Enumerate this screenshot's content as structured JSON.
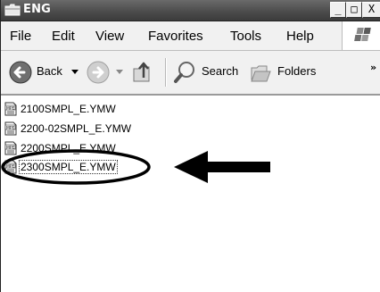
{
  "window": {
    "title": "ENG",
    "controls": {
      "minimize": "_",
      "maximize": "□",
      "close": "X"
    }
  },
  "menu": {
    "items": [
      "File",
      "Edit",
      "View",
      "Favorites",
      "Tools",
      "Help"
    ]
  },
  "toolbar": {
    "back_label": "Back",
    "search_label": "Search",
    "folders_label": "Folders",
    "overflow": "»"
  },
  "files": [
    {
      "name": "2100SMPL_E.YMW",
      "icon": "ymw-file-icon"
    },
    {
      "name": "2200-02SMPL_E.YMW",
      "icon": "ymw-file-icon"
    },
    {
      "name": "2200SMPL_E.YMW",
      "icon": "ymw-file-icon"
    },
    {
      "name": "2300SMPL_E.YMW",
      "icon": "ymw-file-icon"
    }
  ],
  "colors": {
    "titlebar": "#4a4a4a",
    "highlight_ring": "#000000",
    "arrow": "#000000"
  }
}
